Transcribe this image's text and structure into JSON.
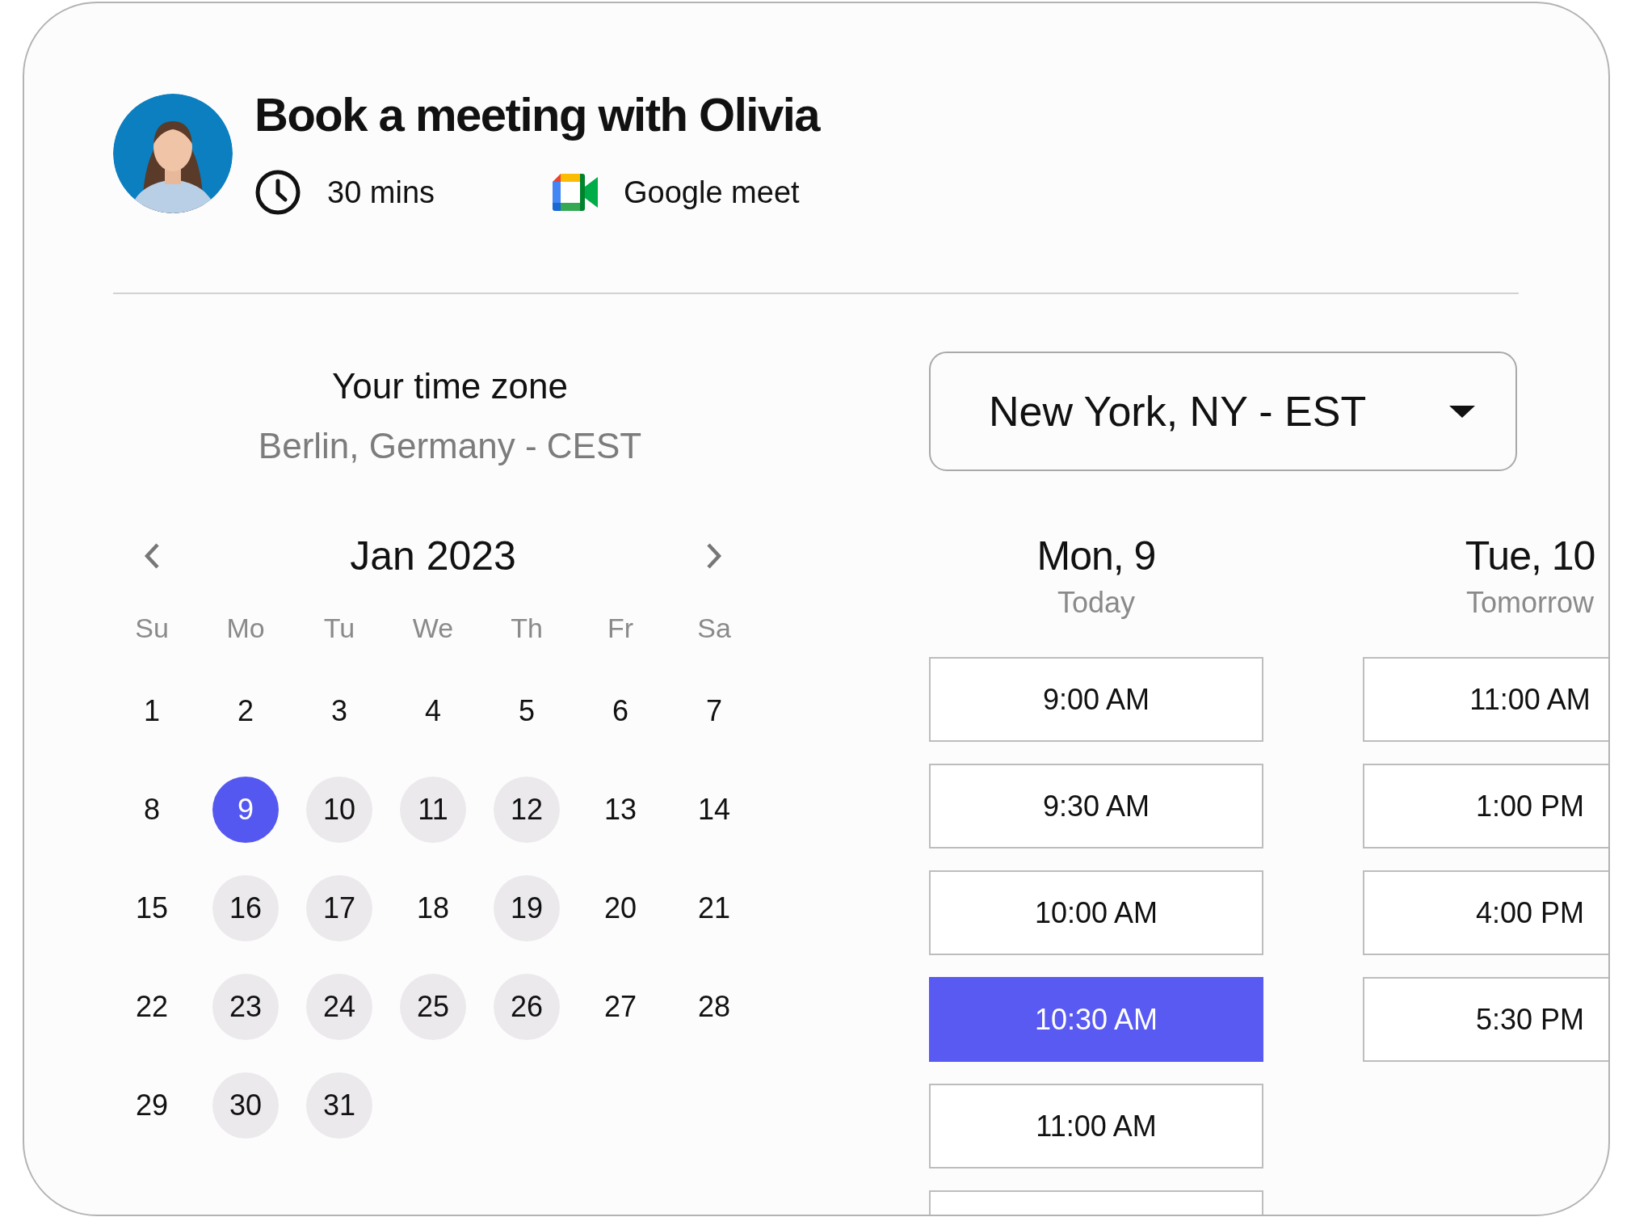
{
  "header": {
    "title": "Book a meeting with Olivia",
    "duration": "30 mins",
    "location": "Google meet"
  },
  "timezone": {
    "label": "Your time zone",
    "value": "Berlin, Germany - CEST"
  },
  "timezone_select": {
    "value": "New York, NY - EST"
  },
  "calendar": {
    "month": "Jan 2023",
    "weekdays": [
      "Su",
      "Mo",
      "Tu",
      "We",
      "Th",
      "Fr",
      "Sa"
    ],
    "days": [
      {
        "label": "1",
        "selected": false,
        "available": false
      },
      {
        "label": "2",
        "selected": false,
        "available": false
      },
      {
        "label": "3",
        "selected": false,
        "available": false
      },
      {
        "label": "4",
        "selected": false,
        "available": false
      },
      {
        "label": "5",
        "selected": false,
        "available": false
      },
      {
        "label": "6",
        "selected": false,
        "available": false
      },
      {
        "label": "7",
        "selected": false,
        "available": false
      },
      {
        "label": "8",
        "selected": false,
        "available": false
      },
      {
        "label": "9",
        "selected": true,
        "available": true
      },
      {
        "label": "10",
        "selected": false,
        "available": true
      },
      {
        "label": "11",
        "selected": false,
        "available": true
      },
      {
        "label": "12",
        "selected": false,
        "available": true
      },
      {
        "label": "13",
        "selected": false,
        "available": false
      },
      {
        "label": "14",
        "selected": false,
        "available": false
      },
      {
        "label": "15",
        "selected": false,
        "available": false
      },
      {
        "label": "16",
        "selected": false,
        "available": true
      },
      {
        "label": "17",
        "selected": false,
        "available": true
      },
      {
        "label": "18",
        "selected": false,
        "available": false
      },
      {
        "label": "19",
        "selected": false,
        "available": true
      },
      {
        "label": "20",
        "selected": false,
        "available": false
      },
      {
        "label": "21",
        "selected": false,
        "available": false
      },
      {
        "label": "22",
        "selected": false,
        "available": false
      },
      {
        "label": "23",
        "selected": false,
        "available": true
      },
      {
        "label": "24",
        "selected": false,
        "available": true
      },
      {
        "label": "25",
        "selected": false,
        "available": true
      },
      {
        "label": "26",
        "selected": false,
        "available": true
      },
      {
        "label": "27",
        "selected": false,
        "available": false
      },
      {
        "label": "28",
        "selected": false,
        "available": false
      },
      {
        "label": "29",
        "selected": false,
        "available": false
      },
      {
        "label": "30",
        "selected": false,
        "available": true
      },
      {
        "label": "31",
        "selected": false,
        "available": true
      }
    ]
  },
  "schedule": [
    {
      "day": "Mon, 9",
      "subtitle": "Today",
      "slots": [
        {
          "label": "9:00 AM",
          "selected": false
        },
        {
          "label": "9:30 AM",
          "selected": false
        },
        {
          "label": "10:00 AM",
          "selected": false
        },
        {
          "label": "10:30 AM",
          "selected": true
        },
        {
          "label": "11:00 AM",
          "selected": false
        },
        {
          "selected": false
        }
      ]
    },
    {
      "day": "Tue, 10",
      "subtitle": "Tomorrow",
      "slots": [
        {
          "label": "11:00 AM",
          "selected": false
        },
        {
          "label": "1:00 PM",
          "selected": false
        },
        {
          "label": "4:00 PM",
          "selected": false
        },
        {
          "label": "5:30 PM",
          "selected": false
        }
      ]
    }
  ]
}
